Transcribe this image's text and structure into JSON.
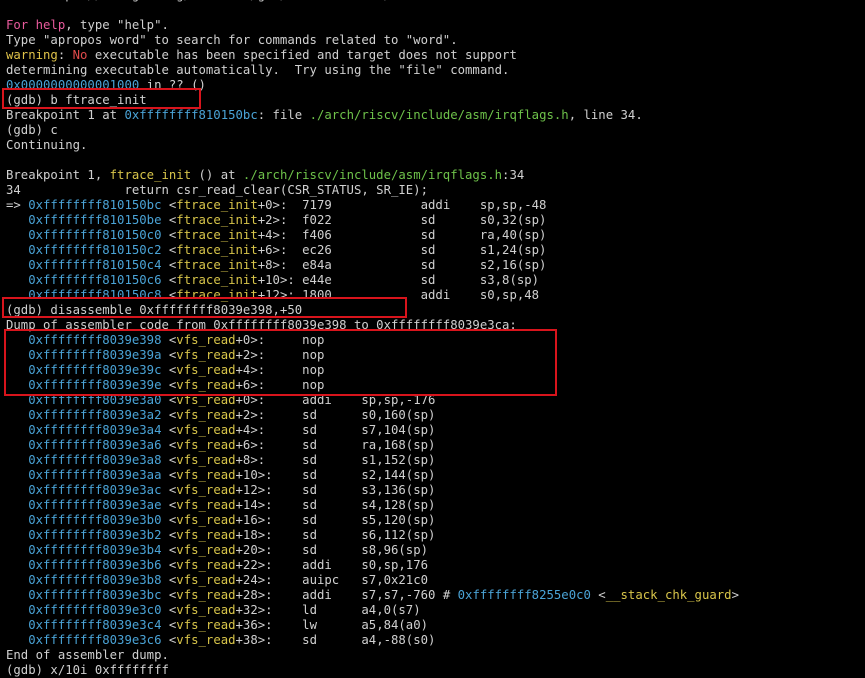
{
  "terminal": {
    "lines": [
      [
        {
          "t": "    <https://www.gnu.org/software/gdb/documentation/>."
        }
      ],
      [
        {
          "t": ""
        }
      ],
      [
        {
          "t": "For help",
          "c": "c-pink"
        },
        {
          "t": ", type \"help\"."
        }
      ],
      [
        {
          "t": "Type \"apropos word\" to search for commands related to \"word\"."
        }
      ],
      [
        {
          "t": "warning",
          "c": "c-yellow"
        },
        {
          "t": ": "
        },
        {
          "t": "No",
          "c": "c-red"
        },
        {
          "t": " executable has been specified and target does not support"
        }
      ],
      [
        {
          "t": "determining executable automatically.  Try using the \"file\" command."
        }
      ],
      [
        {
          "t": "0x0000000000001000",
          "c": "c-addr"
        },
        {
          "t": " in ?? ()"
        }
      ],
      [
        {
          "t": "(gdb) b ftrace_init"
        }
      ],
      [
        {
          "t": "Breakpoint 1 at "
        },
        {
          "t": "0xffffffff810150bc",
          "c": "c-addr"
        },
        {
          "t": ": file "
        },
        {
          "t": "./arch/riscv/include/asm/irqflags.h",
          "c": "c-path"
        },
        {
          "t": ", line 34."
        }
      ],
      [
        {
          "t": "(gdb) c"
        }
      ],
      [
        {
          "t": "Continuing."
        }
      ],
      [
        {
          "t": ""
        }
      ],
      [
        {
          "t": "Breakpoint 1, "
        },
        {
          "t": "ftrace_init",
          "c": "c-sym"
        },
        {
          "t": " () at "
        },
        {
          "t": "./arch/riscv/include/asm/irqflags.h",
          "c": "c-path"
        },
        {
          "t": ":34"
        }
      ],
      [
        {
          "t": "34              return csr_read_clear(CSR_STATUS, SR_IE);"
        }
      ],
      [
        {
          "t": "=> "
        },
        {
          "t": "0xffffffff810150bc",
          "c": "c-addr"
        },
        {
          "t": " <"
        },
        {
          "t": "ftrace_init",
          "c": "c-sym"
        },
        {
          "t": "+0>:  7179            addi    sp,sp,-48"
        }
      ],
      [
        {
          "t": "   "
        },
        {
          "t": "0xffffffff810150be",
          "c": "c-addr"
        },
        {
          "t": " <"
        },
        {
          "t": "ftrace_init",
          "c": "c-sym"
        },
        {
          "t": "+2>:  f022            sd      s0,32(sp)"
        }
      ],
      [
        {
          "t": "   "
        },
        {
          "t": "0xffffffff810150c0",
          "c": "c-addr"
        },
        {
          "t": " <"
        },
        {
          "t": "ftrace_init",
          "c": "c-sym"
        },
        {
          "t": "+4>:  f406            sd      ra,40(sp)"
        }
      ],
      [
        {
          "t": "   "
        },
        {
          "t": "0xffffffff810150c2",
          "c": "c-addr"
        },
        {
          "t": " <"
        },
        {
          "t": "ftrace_init",
          "c": "c-sym"
        },
        {
          "t": "+6>:  ec26            sd      s1,24(sp)"
        }
      ],
      [
        {
          "t": "   "
        },
        {
          "t": "0xffffffff810150c4",
          "c": "c-addr"
        },
        {
          "t": " <"
        },
        {
          "t": "ftrace_init",
          "c": "c-sym"
        },
        {
          "t": "+8>:  e84a            sd      s2,16(sp)"
        }
      ],
      [
        {
          "t": "   "
        },
        {
          "t": "0xffffffff810150c6",
          "c": "c-addr"
        },
        {
          "t": " <"
        },
        {
          "t": "ftrace_init",
          "c": "c-sym"
        },
        {
          "t": "+10>: e44e            sd      s3,8(sp)"
        }
      ],
      [
        {
          "t": "   "
        },
        {
          "t": "0xffffffff810150c8",
          "c": "c-addr"
        },
        {
          "t": " <"
        },
        {
          "t": "ftrace_init",
          "c": "c-sym"
        },
        {
          "t": "+12>: 1800            addi    s0,sp,48"
        }
      ],
      [
        {
          "t": "(gdb) disassemble 0xffffffff8039e398,+50"
        }
      ],
      [
        {
          "t": "Dump of assembler code from 0xffffffff8039e398 to 0xffffffff8039e3ca:"
        }
      ],
      [
        {
          "t": "   "
        },
        {
          "t": "0xffffffff8039e398",
          "c": "c-addr"
        },
        {
          "t": " <"
        },
        {
          "t": "vfs_read",
          "c": "c-sym"
        },
        {
          "t": "+0>:     nop"
        }
      ],
      [
        {
          "t": "   "
        },
        {
          "t": "0xffffffff8039e39a",
          "c": "c-addr"
        },
        {
          "t": " <"
        },
        {
          "t": "vfs_read",
          "c": "c-sym"
        },
        {
          "t": "+2>:     nop"
        }
      ],
      [
        {
          "t": "   "
        },
        {
          "t": "0xffffffff8039e39c",
          "c": "c-addr"
        },
        {
          "t": " <"
        },
        {
          "t": "vfs_read",
          "c": "c-sym"
        },
        {
          "t": "+4>:     nop"
        }
      ],
      [
        {
          "t": "   "
        },
        {
          "t": "0xffffffff8039e39e",
          "c": "c-addr"
        },
        {
          "t": " <"
        },
        {
          "t": "vfs_read",
          "c": "c-sym"
        },
        {
          "t": "+6>:     nop"
        }
      ],
      [
        {
          "t": "   "
        },
        {
          "t": "0xffffffff8039e3a0",
          "c": "c-addr"
        },
        {
          "t": " <"
        },
        {
          "t": "vfs_read",
          "c": "c-sym"
        },
        {
          "t": "+0>:     addi    sp,sp,-176"
        }
      ],
      [
        {
          "t": "   "
        },
        {
          "t": "0xffffffff8039e3a2",
          "c": "c-addr"
        },
        {
          "t": " <"
        },
        {
          "t": "vfs_read",
          "c": "c-sym"
        },
        {
          "t": "+2>:     sd      s0,160(sp)"
        }
      ],
      [
        {
          "t": "   "
        },
        {
          "t": "0xffffffff8039e3a4",
          "c": "c-addr"
        },
        {
          "t": " <"
        },
        {
          "t": "vfs_read",
          "c": "c-sym"
        },
        {
          "t": "+4>:     sd      s7,104(sp)"
        }
      ],
      [
        {
          "t": "   "
        },
        {
          "t": "0xffffffff8039e3a6",
          "c": "c-addr"
        },
        {
          "t": " <"
        },
        {
          "t": "vfs_read",
          "c": "c-sym"
        },
        {
          "t": "+6>:     sd      ra,168(sp)"
        }
      ],
      [
        {
          "t": "   "
        },
        {
          "t": "0xffffffff8039e3a8",
          "c": "c-addr"
        },
        {
          "t": " <"
        },
        {
          "t": "vfs_read",
          "c": "c-sym"
        },
        {
          "t": "+8>:     sd      s1,152(sp)"
        }
      ],
      [
        {
          "t": "   "
        },
        {
          "t": "0xffffffff8039e3aa",
          "c": "c-addr"
        },
        {
          "t": " <"
        },
        {
          "t": "vfs_read",
          "c": "c-sym"
        },
        {
          "t": "+10>:    sd      s2,144(sp)"
        }
      ],
      [
        {
          "t": "   "
        },
        {
          "t": "0xffffffff8039e3ac",
          "c": "c-addr"
        },
        {
          "t": " <"
        },
        {
          "t": "vfs_read",
          "c": "c-sym"
        },
        {
          "t": "+12>:    sd      s3,136(sp)"
        }
      ],
      [
        {
          "t": "   "
        },
        {
          "t": "0xffffffff8039e3ae",
          "c": "c-addr"
        },
        {
          "t": " <"
        },
        {
          "t": "vfs_read",
          "c": "c-sym"
        },
        {
          "t": "+14>:    sd      s4,128(sp)"
        }
      ],
      [
        {
          "t": "   "
        },
        {
          "t": "0xffffffff8039e3b0",
          "c": "c-addr"
        },
        {
          "t": " <"
        },
        {
          "t": "vfs_read",
          "c": "c-sym"
        },
        {
          "t": "+16>:    sd      s5,120(sp)"
        }
      ],
      [
        {
          "t": "   "
        },
        {
          "t": "0xffffffff8039e3b2",
          "c": "c-addr"
        },
        {
          "t": " <"
        },
        {
          "t": "vfs_read",
          "c": "c-sym"
        },
        {
          "t": "+18>:    sd      s6,112(sp)"
        }
      ],
      [
        {
          "t": "   "
        },
        {
          "t": "0xffffffff8039e3b4",
          "c": "c-addr"
        },
        {
          "t": " <"
        },
        {
          "t": "vfs_read",
          "c": "c-sym"
        },
        {
          "t": "+20>:    sd      s8,96(sp)"
        }
      ],
      [
        {
          "t": "   "
        },
        {
          "t": "0xffffffff8039e3b6",
          "c": "c-addr"
        },
        {
          "t": " <"
        },
        {
          "t": "vfs_read",
          "c": "c-sym"
        },
        {
          "t": "+22>:    addi    s0,sp,176"
        }
      ],
      [
        {
          "t": "   "
        },
        {
          "t": "0xffffffff8039e3b8",
          "c": "c-addr"
        },
        {
          "t": " <"
        },
        {
          "t": "vfs_read",
          "c": "c-sym"
        },
        {
          "t": "+24>:    auipc   s7,0x21c0"
        }
      ],
      [
        {
          "t": "   "
        },
        {
          "t": "0xffffffff8039e3bc",
          "c": "c-addr"
        },
        {
          "t": " <"
        },
        {
          "t": "vfs_read",
          "c": "c-sym"
        },
        {
          "t": "+28>:    addi    s7,s7,-760 # "
        },
        {
          "t": "0xffffffff8255e0c0",
          "c": "c-addr"
        },
        {
          "t": " <"
        },
        {
          "t": "__stack_chk_guard",
          "c": "c-sym"
        },
        {
          "t": ">"
        }
      ],
      [
        {
          "t": "   "
        },
        {
          "t": "0xffffffff8039e3c0",
          "c": "c-addr"
        },
        {
          "t": " <"
        },
        {
          "t": "vfs_read",
          "c": "c-sym"
        },
        {
          "t": "+32>:    ld      a4,0(s7)"
        }
      ],
      [
        {
          "t": "   "
        },
        {
          "t": "0xffffffff8039e3c4",
          "c": "c-addr"
        },
        {
          "t": " <"
        },
        {
          "t": "vfs_read",
          "c": "c-sym"
        },
        {
          "t": "+36>:    lw      a5,84(a0)"
        }
      ],
      [
        {
          "t": "   "
        },
        {
          "t": "0xffffffff8039e3c6",
          "c": "c-addr"
        },
        {
          "t": " <"
        },
        {
          "t": "vfs_read",
          "c": "c-sym"
        },
        {
          "t": "+38>:    sd      a4,-88(s0)"
        }
      ],
      [
        {
          "t": "End of assembler dump."
        }
      ],
      [
        {
          "t": "(gdb) x/10i 0xffffffff"
        }
      ]
    ]
  }
}
